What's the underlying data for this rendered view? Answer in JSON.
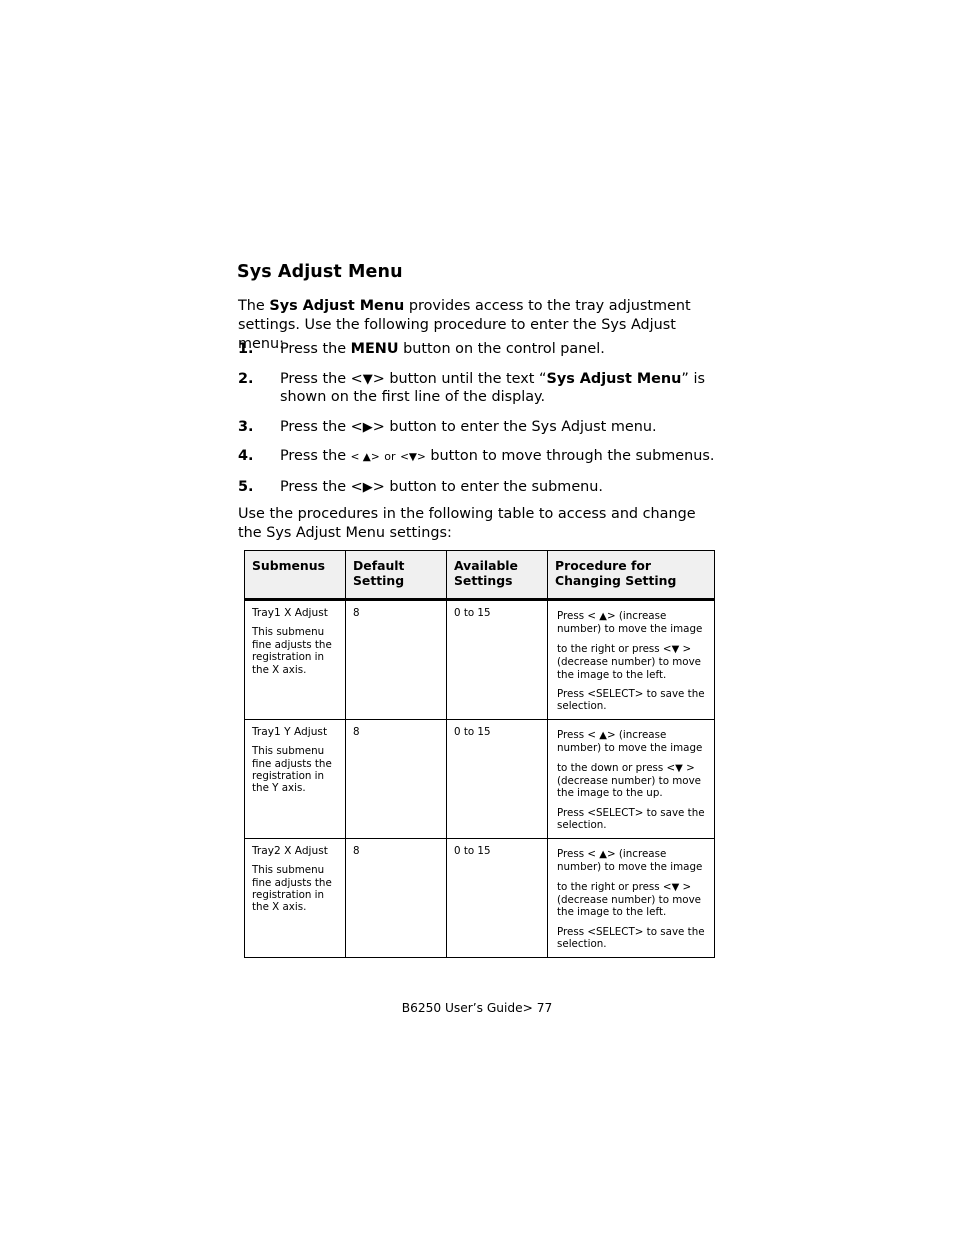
{
  "document": {
    "heading": "Sys Adjust Menu",
    "intro": {
      "before": "The ",
      "bold": "Sys Adjust Menu",
      "after": " provides access to the tray adjustment settings. Use the following procedure to enter the Sys Adjust menu:"
    },
    "steps": [
      {
        "number": "1.",
        "text_before": "Press the ",
        "bold": "MENU",
        "text_after": " button on the control panel."
      },
      {
        "number": "2.",
        "text_before": "Press the <▼> button until the text “",
        "bold": "Sys Adjust Menu",
        "text_after": "” is shown on the first line of the display."
      },
      {
        "number": "3.",
        "text_before": "Press the <▶> button to enter the Sys Adjust menu.",
        "bold": "",
        "text_after": ""
      },
      {
        "number": "4.",
        "text_before": "Press the <▲> or <▼> button to move through the submenus.",
        "bold": "",
        "text_after": ""
      },
      {
        "number": "5.",
        "text_before": "Press the <▶> button to enter the submenu.",
        "bold": "",
        "text_after": ""
      }
    ],
    "table_intro": "Use the procedures in the following table to access and change the Sys Adjust Menu settings:",
    "table": {
      "headers": [
        "Submenus",
        "Default Setting",
        "Available Settings",
        "Procedure for Changing Setting"
      ],
      "rows": [
        {
          "submenu_title": "Tray1 X Adjust",
          "submenu_desc": "This submenu fine adjusts the registration in the X axis.",
          "default_setting": "8",
          "available_settings": "0 to 15",
          "procedure": [
            "Press < ▲> (increase number) to move the image",
            "to the right or press <▼ > (decrease number) to move the image to the left.",
            "Press <SELECT> to save the selection."
          ]
        },
        {
          "submenu_title": "Tray1 Y Adjust",
          "submenu_desc": "This submenu fine adjusts the registration in the Y axis.",
          "default_setting": "8",
          "available_settings": "0 to 15",
          "procedure": [
            "Press < ▲> (increase number) to move the image",
            "to the down or press <▼ > (decrease number) to move the image to the up.",
            "Press <SELECT> to save the selection."
          ]
        },
        {
          "submenu_title": "Tray2 X Adjust",
          "submenu_desc": "This submenu fine adjusts the registration in the X axis.",
          "default_setting": "8",
          "available_settings": "0 to 15",
          "procedure": [
            "Press < ▲> (increase number) to move the image",
            "to the right or press <▼ > (decrease number) to move the image to the left.",
            "Press <SELECT> to save the selection."
          ]
        }
      ]
    },
    "footer": "B6250 User’s Guide> 77"
  }
}
